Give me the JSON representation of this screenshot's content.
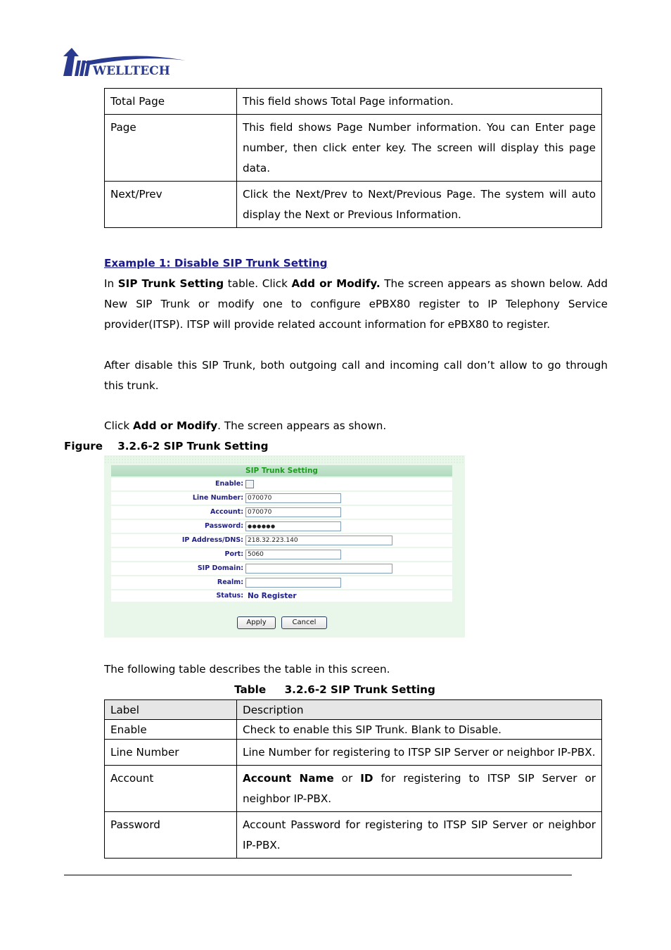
{
  "logo": {
    "text": "WELLTECH",
    "color": "#2a3a8f"
  },
  "top_table": {
    "rows": [
      {
        "label": "Total Page",
        "description": "This field shows Total Page information."
      },
      {
        "label": "Page",
        "description": "This field shows Page Number information. You can Enter page number, then click enter key. The screen will display this page data."
      },
      {
        "label": "Next/Prev",
        "description": "Click the Next/Prev to Next/Previous Page. The system will auto display the Next or Previous Information."
      }
    ]
  },
  "example": {
    "heading": "Example 1: Disable SIP Trunk Setting",
    "p1": {
      "t1": "In ",
      "b1": "SIP Trunk Setting",
      "t2": " table. Click ",
      "b2": "Add or Modify.",
      "t3": " The screen appears as shown below. Add New SIP Trunk or modify one to configure ePBX80 register to IP Telephony Service provider(ITSP). ITSP will provide related account information for ePBX80 to register."
    },
    "p2": "After disable this SIP Trunk, both outgoing call and incoming call don’t allow to go through this trunk.",
    "p3": {
      "t1": "Click ",
      "b1": "Add or Modify",
      "t2": ". The screen appears as shown."
    }
  },
  "figure_caption": "Figure    3.2.6-2 SIP Trunk Setting",
  "sip_form": {
    "title": "SIP Trunk Setting",
    "fields": {
      "enable": {
        "label": "Enable:",
        "checked": false
      },
      "line_number": {
        "label": "Line Number:",
        "value": "070070"
      },
      "account": {
        "label": "Account:",
        "value": "070070"
      },
      "password": {
        "label": "Password:",
        "value": "●●●●●●"
      },
      "ip_address": {
        "label": "IP Address/DNS:",
        "value": "218.32.223.140"
      },
      "port": {
        "label": "Port:",
        "value": "5060"
      },
      "sip_domain": {
        "label": "SIP Domain:",
        "value": ""
      },
      "realm": {
        "label": "Realm:",
        "value": ""
      },
      "status": {
        "label": "Status:",
        "value": "No Register"
      }
    },
    "apply_label": "Apply",
    "cancel_label": "Cancel"
  },
  "intro_text": "The following table describes the table in this screen.",
  "table_caption": "Table     3.2.6-2 SIP Trunk Setting",
  "desc_table": {
    "headers": {
      "label": "Label",
      "description": "Description"
    },
    "rows": [
      {
        "label": "Enable",
        "description": "Check to enable this SIP Trunk. Blank to Disable."
      },
      {
        "label": "Line Number",
        "description": "Line Number for registering to ITSP SIP Server or neighbor IP-PBX."
      },
      {
        "label": "Account",
        "desc_b1": "Account Name",
        "desc_t1": " or ",
        "desc_b2": "ID",
        "desc_t2": " for registering to ITSP SIP Server or neighbor IP-PBX."
      },
      {
        "label": "Password",
        "description": "Account Password for registering to ITSP SIP Server or neighbor IP-PBX."
      }
    ]
  }
}
